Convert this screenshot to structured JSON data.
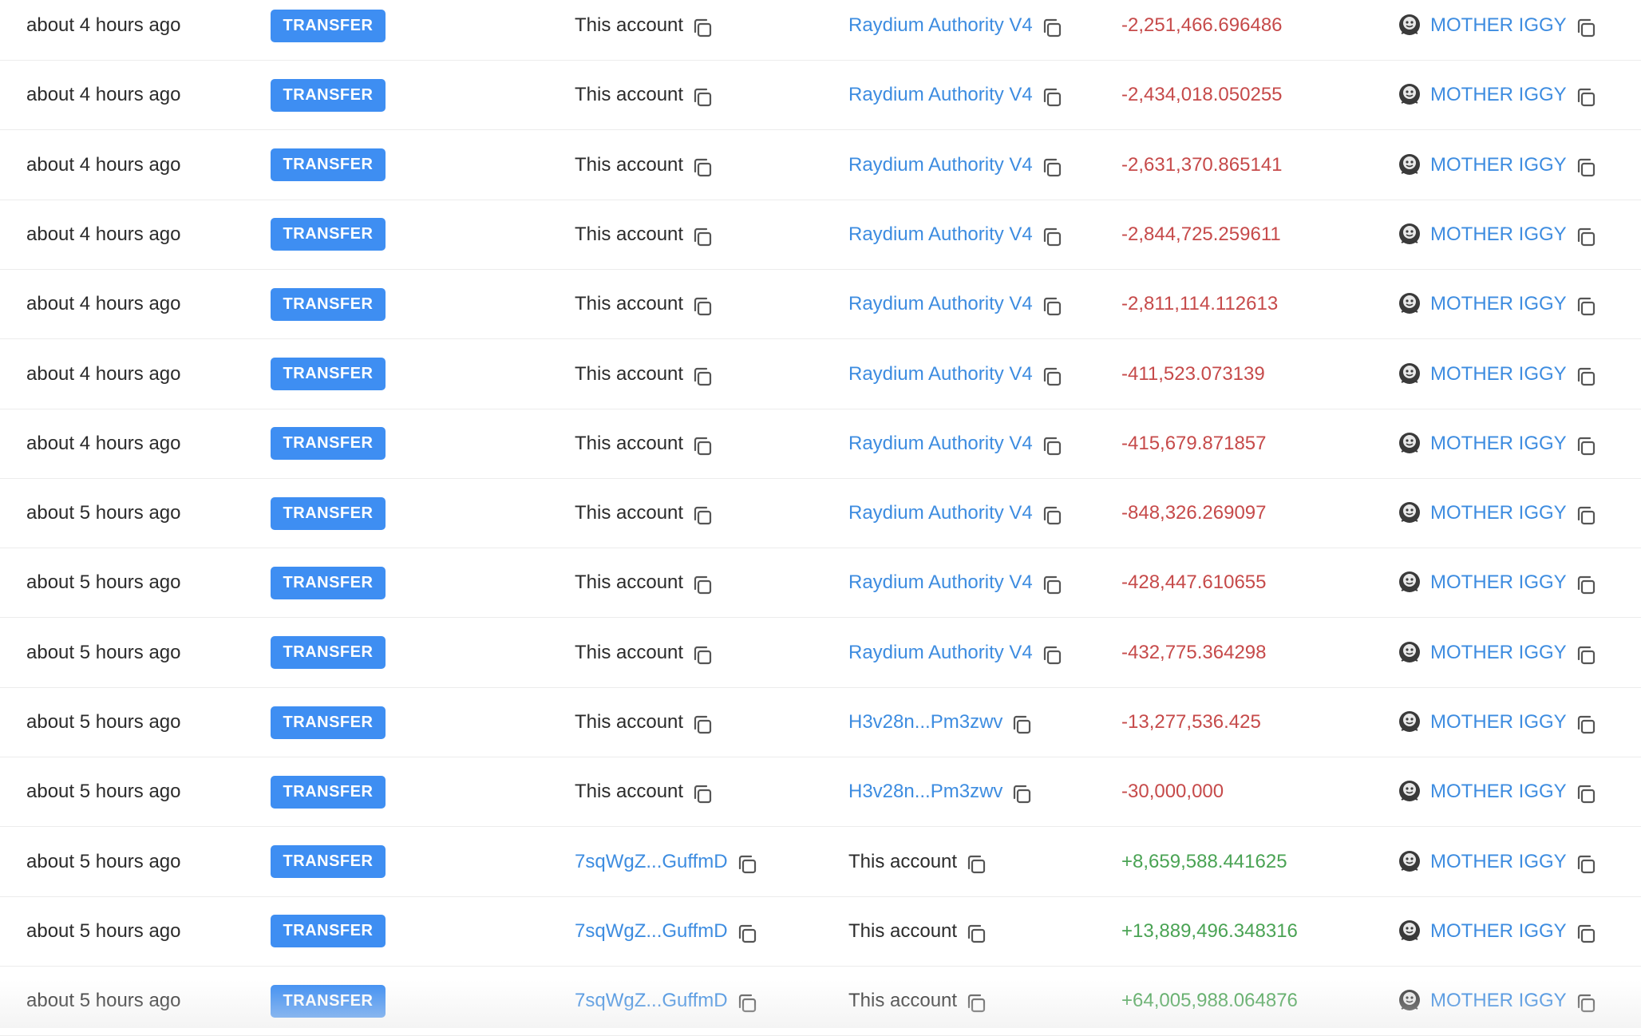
{
  "colors": {
    "badge": "#3e8ef2",
    "link": "#3d8ce0",
    "negative": "#c64a4a",
    "positive": "#4aa354",
    "text": "#2b2b2b"
  },
  "icons": {
    "copy": "copy-icon",
    "token": "token-logo-icon"
  },
  "rows": [
    {
      "time": "about 4 hours ago",
      "type": "TRANSFER",
      "from": "This account",
      "from_link": false,
      "to": "Raydium Authority V4",
      "to_link": true,
      "amount": "-2,251,466.696486",
      "sign": "neg",
      "token": "MOTHER IGGY"
    },
    {
      "time": "about 4 hours ago",
      "type": "TRANSFER",
      "from": "This account",
      "from_link": false,
      "to": "Raydium Authority V4",
      "to_link": true,
      "amount": "-2,434,018.050255",
      "sign": "neg",
      "token": "MOTHER IGGY"
    },
    {
      "time": "about 4 hours ago",
      "type": "TRANSFER",
      "from": "This account",
      "from_link": false,
      "to": "Raydium Authority V4",
      "to_link": true,
      "amount": "-2,631,370.865141",
      "sign": "neg",
      "token": "MOTHER IGGY"
    },
    {
      "time": "about 4 hours ago",
      "type": "TRANSFER",
      "from": "This account",
      "from_link": false,
      "to": "Raydium Authority V4",
      "to_link": true,
      "amount": "-2,844,725.259611",
      "sign": "neg",
      "token": "MOTHER IGGY"
    },
    {
      "time": "about 4 hours ago",
      "type": "TRANSFER",
      "from": "This account",
      "from_link": false,
      "to": "Raydium Authority V4",
      "to_link": true,
      "amount": "-2,811,114.112613",
      "sign": "neg",
      "token": "MOTHER IGGY"
    },
    {
      "time": "about 4 hours ago",
      "type": "TRANSFER",
      "from": "This account",
      "from_link": false,
      "to": "Raydium Authority V4",
      "to_link": true,
      "amount": "-411,523.073139",
      "sign": "neg",
      "token": "MOTHER IGGY"
    },
    {
      "time": "about 4 hours ago",
      "type": "TRANSFER",
      "from": "This account",
      "from_link": false,
      "to": "Raydium Authority V4",
      "to_link": true,
      "amount": "-415,679.871857",
      "sign": "neg",
      "token": "MOTHER IGGY"
    },
    {
      "time": "about 5 hours ago",
      "type": "TRANSFER",
      "from": "This account",
      "from_link": false,
      "to": "Raydium Authority V4",
      "to_link": true,
      "amount": "-848,326.269097",
      "sign": "neg",
      "token": "MOTHER IGGY"
    },
    {
      "time": "about 5 hours ago",
      "type": "TRANSFER",
      "from": "This account",
      "from_link": false,
      "to": "Raydium Authority V4",
      "to_link": true,
      "amount": "-428,447.610655",
      "sign": "neg",
      "token": "MOTHER IGGY"
    },
    {
      "time": "about 5 hours ago",
      "type": "TRANSFER",
      "from": "This account",
      "from_link": false,
      "to": "Raydium Authority V4",
      "to_link": true,
      "amount": "-432,775.364298",
      "sign": "neg",
      "token": "MOTHER IGGY"
    },
    {
      "time": "about 5 hours ago",
      "type": "TRANSFER",
      "from": "This account",
      "from_link": false,
      "to": "H3v28n...Pm3zwv",
      "to_link": true,
      "amount": "-13,277,536.425",
      "sign": "neg",
      "token": "MOTHER IGGY"
    },
    {
      "time": "about 5 hours ago",
      "type": "TRANSFER",
      "from": "This account",
      "from_link": false,
      "to": "H3v28n...Pm3zwv",
      "to_link": true,
      "amount": "-30,000,000",
      "sign": "neg",
      "token": "MOTHER IGGY"
    },
    {
      "time": "about 5 hours ago",
      "type": "TRANSFER",
      "from": "7sqWgZ...GuffmD",
      "from_link": true,
      "to": "This account",
      "to_link": false,
      "amount": "+8,659,588.441625",
      "sign": "pos",
      "token": "MOTHER IGGY"
    },
    {
      "time": "about 5 hours ago",
      "type": "TRANSFER",
      "from": "7sqWgZ...GuffmD",
      "from_link": true,
      "to": "This account",
      "to_link": false,
      "amount": "+13,889,496.348316",
      "sign": "pos",
      "token": "MOTHER IGGY"
    },
    {
      "time": "about 5 hours ago",
      "type": "TRANSFER",
      "from": "7sqWgZ...GuffmD",
      "from_link": true,
      "to": "This account",
      "to_link": false,
      "amount": "+64,005,988.064876",
      "sign": "pos",
      "token": "MOTHER IGGY"
    }
  ]
}
